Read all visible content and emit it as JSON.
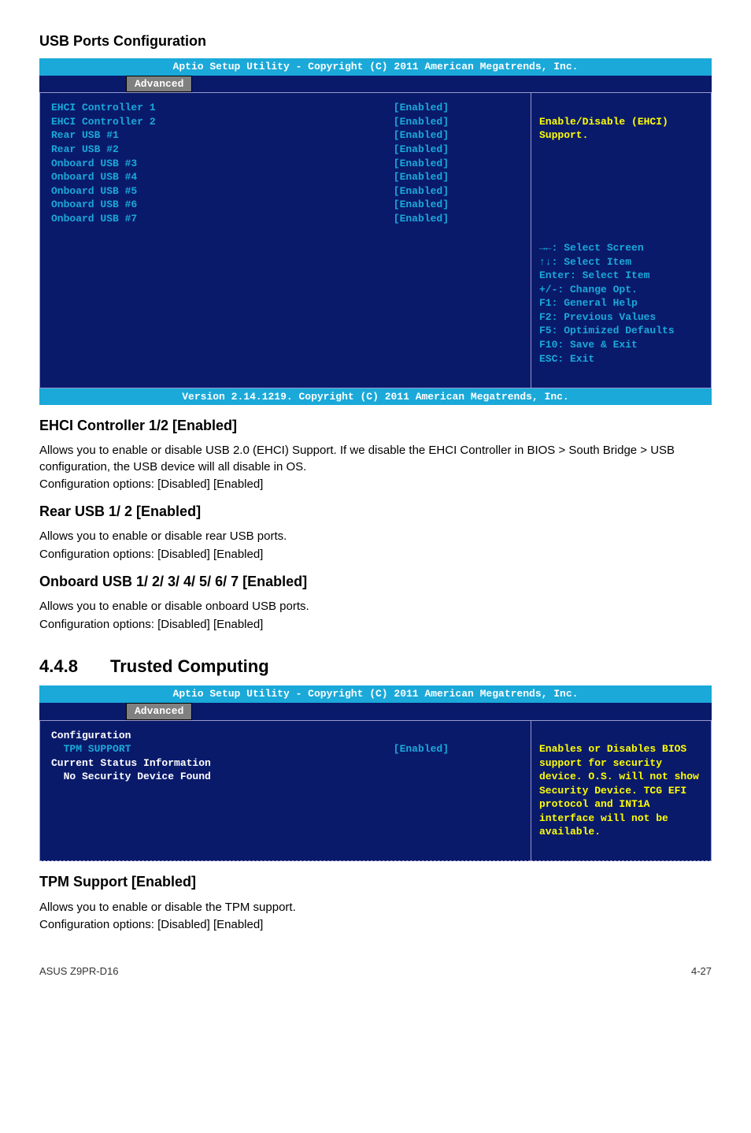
{
  "usb_section": {
    "title": "USB Ports Configuration",
    "bios": {
      "header": "Aptio Setup Utility - Copyright (C) 2011 American Megatrends, Inc.",
      "tab": "Advanced",
      "rows": [
        {
          "label": "EHCI Controller 1",
          "value": "[Enabled]"
        },
        {
          "label": "EHCI Controller 2",
          "value": "[Enabled]"
        },
        {
          "label": "",
          "value": ""
        },
        {
          "label": "",
          "value": ""
        },
        {
          "label": "Rear USB #1",
          "value": "[Enabled]"
        },
        {
          "label": "Rear USB #2",
          "value": "[Enabled]"
        },
        {
          "label": "Onboard USB #3",
          "value": "[Enabled]"
        },
        {
          "label": "Onboard USB #4",
          "value": "[Enabled]"
        },
        {
          "label": "Onboard USB #5",
          "value": "[Enabled]"
        },
        {
          "label": "Onboard USB #6",
          "value": "[Enabled]"
        },
        {
          "label": "Onboard USB #7",
          "value": "[Enabled]"
        }
      ],
      "help": "Enable/Disable (EHCI) Support.",
      "nav": "→←: Select Screen\n↑↓:  Select Item\nEnter: Select Item\n+/-: Change Opt.\nF1: General Help\nF2: Previous Values\nF5: Optimized Defaults\nF10: Save & Exit\nESC: Exit",
      "footer": "Version 2.14.1219. Copyright (C) 2011 American Megatrends, Inc."
    },
    "ehci": {
      "title": "EHCI Controller 1/2 [Enabled]",
      "p1": "Allows you to enable or disable USB 2.0 (EHCI) Support. If we disable the EHCI Controller in BIOS > South Bridge > USB configuration, the USB device will all disable in OS.",
      "p2": "Configuration options: [Disabled] [Enabled]"
    },
    "rear": {
      "title": "Rear USB 1/ 2 [Enabled]",
      "p1": "Allows you to enable or disable rear USB ports.",
      "p2": "Configuration options: [Disabled] [Enabled]"
    },
    "onboard": {
      "title": "Onboard USB 1/ 2/ 3/ 4/ 5/ 6/ 7 [Enabled]",
      "p1": "Allows you to enable or disable onboard USB ports.",
      "p2": "Configuration options: [Disabled] [Enabled]"
    }
  },
  "trusted": {
    "number": "4.4.8",
    "title": "Trusted Computing",
    "bios": {
      "header": "Aptio Setup Utility - Copyright (C) 2011 American Megatrends, Inc.",
      "tab": "Advanced",
      "rows": [
        {
          "label": "Configuration",
          "value": ""
        },
        {
          "label": "  TPM SUPPORT",
          "value": "[Enabled]"
        },
        {
          "label": "",
          "value": ""
        },
        {
          "label": "Current Status Information",
          "value": ""
        },
        {
          "label": "  No Security Device Found",
          "value": ""
        }
      ],
      "help": "Enables or Disables BIOS support for security device. O.S. will not show Security Device. TCG EFI protocol and INT1A interface will not be available."
    },
    "tpm": {
      "title": "TPM Support [Enabled]",
      "p1": "Allows you to enable or disable the TPM support.",
      "p2": "Configuration options: [Disabled] [Enabled]"
    }
  },
  "footer": {
    "left": "ASUS Z9PR-D16",
    "right": "4-27"
  }
}
